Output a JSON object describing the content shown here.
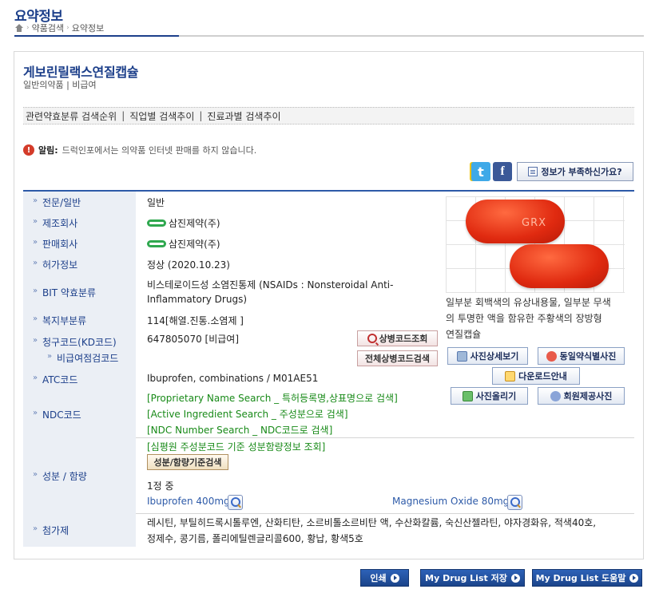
{
  "header": {
    "title": "요약정보",
    "breadcrumb": [
      "약품검색",
      "요약정보"
    ]
  },
  "drug": {
    "name": "게보린릴랙스연질캡슐",
    "subtitle": "일반의약품 | 비급여"
  },
  "rank_bar": {
    "items": [
      "관련약효분류 검색순위",
      "직업별 검색추이",
      "진료과별 검색추이"
    ],
    "separator": "|"
  },
  "notice": {
    "label": "알림:",
    "text": "드럭인포에서는 의약품 인터넷 판매를 하지 않습니다."
  },
  "social": {
    "kakao_icon": "kakao-story-icon",
    "twitter_icon": "twitter-icon",
    "facebook_icon": "facebook-icon",
    "info_button": "정보가 부족하신가요?"
  },
  "info": {
    "category_label": "전문/일반",
    "category_value": "일반",
    "manufacturer_label": "제조회사",
    "manufacturer_value": "삼진제약(주)",
    "seller_label": "판매회사",
    "seller_value": "삼진제약(주)",
    "approval_label": "허가정보",
    "approval_value": "정상 (2020.10.23)",
    "bit_label": "BIT 약효분류",
    "bit_value_line1": "비스테로이드성 소염진통제 (NSAIDs : Nonsteroidal Anti-",
    "bit_value_line2": "Inflammatory Drugs)",
    "welfare_label": "복지부분류",
    "welfare_value": "114[해열.진통.소염제 ]",
    "claim_label_line1": "청구코드(KD코드)",
    "claim_label_line2": "비급여점검코드",
    "claim_value": "647805070   [비급여]",
    "claim_btn1": "상병코드조회",
    "claim_btn2": "전체상병코드검색",
    "atc_label": "ATC코드",
    "atc_value": "Ibuprofen, combinations / M01AE51",
    "ndc_label": "NDC코드",
    "ndc_links": [
      "[Proprietary Name Search _ 특허등록명,상표명으로 검색]",
      "[Active Ingredient Search _ 주성분으로 검색]",
      "[NDC Number Search _ NDC코드로 검색]"
    ],
    "ingredient_label": "성분 / 함량",
    "ingredient_link": "[심평원 주성분코드 기준 성분함량정보 조회]",
    "ingredient_btn": "성분/함량기준검색",
    "per_unit": "1정 중",
    "ingredients": [
      "Ibuprofen 400mg",
      "Magnesium Oxide 80mg"
    ],
    "additive_label": "첨가제",
    "additive_line1": "레시틴, 부틸히드록시톨루엔, 산화티탄, 소르비톨소르비탄 액, 수산화칼륨, 숙신산젤라틴, 야자경화유, 적색40호,",
    "additive_line2": "정제수, 콩기름, 폴리에틸렌글리콜600, 황납, 황색5호"
  },
  "pill": {
    "imprint": "GRX",
    "desc_line1": "일부분 회백색의 유상내용물, 일부분 무색",
    "desc_line2": "의 투명한 액을 함유한 주황색의 장방형",
    "desc_line3": "연질캡슐",
    "btn_detail": "사진상세보기",
    "btn_same": "동일약식별사진",
    "btn_download": "다운로드안내",
    "btn_upload": "사진올리기",
    "btn_member": "회원제공사진"
  },
  "footer": {
    "print": "인쇄",
    "save": "My Drug List 저장",
    "help": "My Drug List 도움말"
  }
}
